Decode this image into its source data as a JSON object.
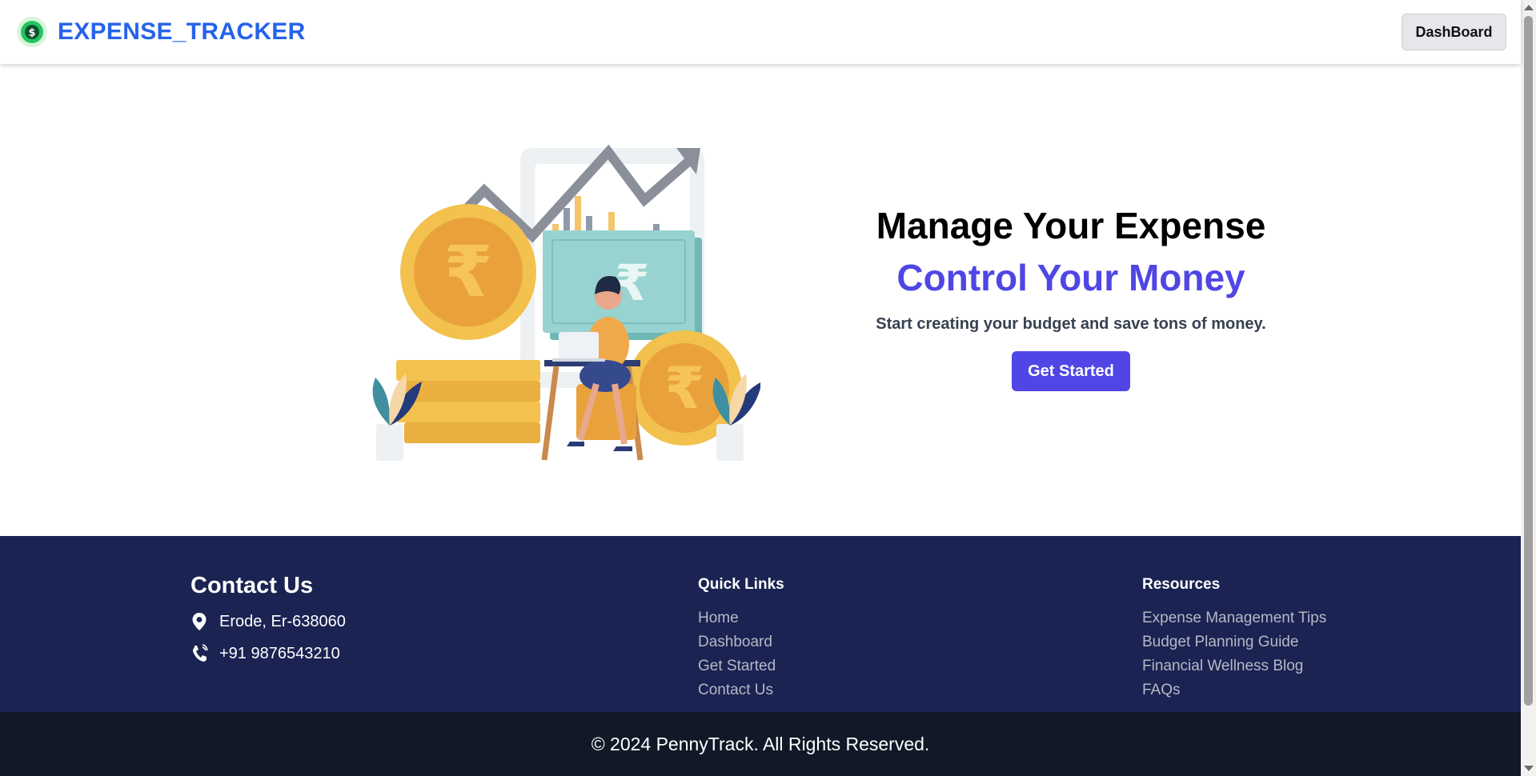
{
  "header": {
    "brand": "EXPENSE_TRACKER",
    "logo_icon": "money-leaf-icon",
    "dashboard_button": "DashBoard"
  },
  "hero": {
    "title": "Manage Your Expense",
    "subtitle": "Control Your Money",
    "description": "Start creating your budget and save tons of money.",
    "cta_label": "Get Started",
    "illustration": "finance-illustration"
  },
  "footer": {
    "contact": {
      "title": "Contact Us",
      "address": "Erode, Er-638060",
      "phone": "+91 9876543210",
      "address_icon": "location-pin-icon",
      "phone_icon": "phone-icon"
    },
    "quick_links": {
      "title": "Quick Links",
      "items": [
        "Home",
        "Dashboard",
        "Get Started",
        "Contact Us"
      ]
    },
    "resources": {
      "title": "Resources",
      "items": [
        "Expense Management Tips",
        "Budget Planning Guide",
        "Financial Wellness Blog",
        "FAQs"
      ]
    },
    "copyright": "© 2024 PennyTrack. All Rights Reserved."
  },
  "colors": {
    "brand": "#2563eb",
    "accent": "#4f46e5",
    "footer_bg": "#1a2352",
    "copyright_bg": "#111827"
  }
}
